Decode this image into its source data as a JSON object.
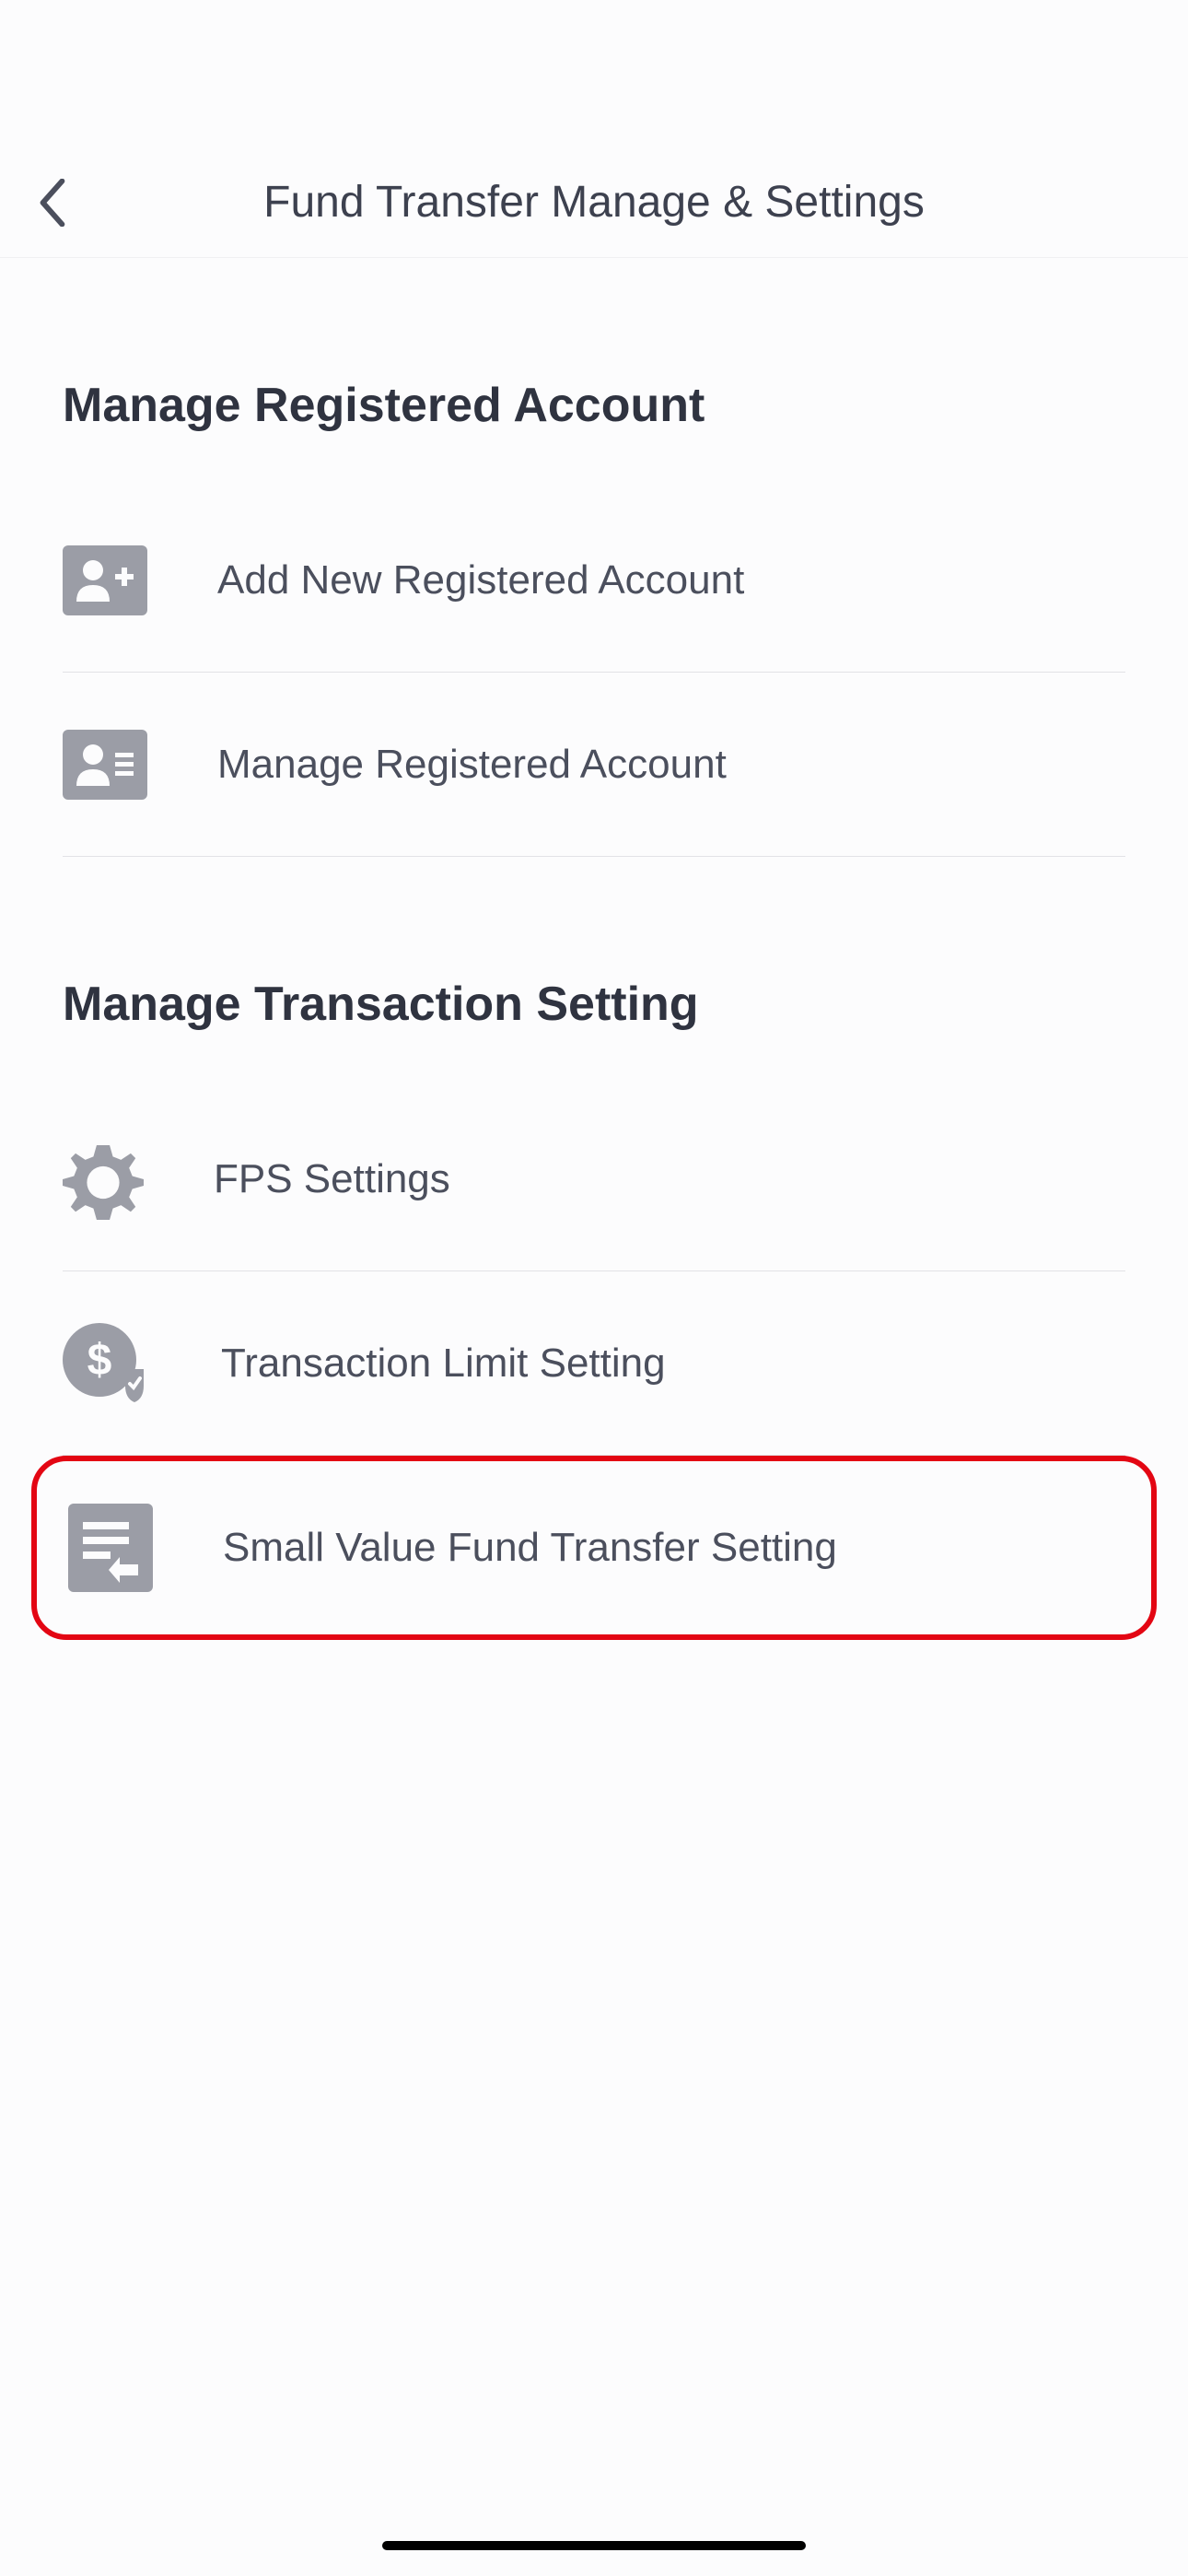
{
  "header": {
    "title": "Fund Transfer Manage & Settings"
  },
  "sections": {
    "registered": {
      "title": "Manage Registered Account",
      "items": [
        {
          "label": "Add New Registered Account"
        },
        {
          "label": "Manage Registered Account"
        }
      ]
    },
    "transaction": {
      "title": "Manage Transaction Setting",
      "items": [
        {
          "label": "FPS Settings"
        },
        {
          "label": "Transaction Limit Setting"
        },
        {
          "label": "Small Value Fund Transfer Setting"
        }
      ]
    }
  }
}
